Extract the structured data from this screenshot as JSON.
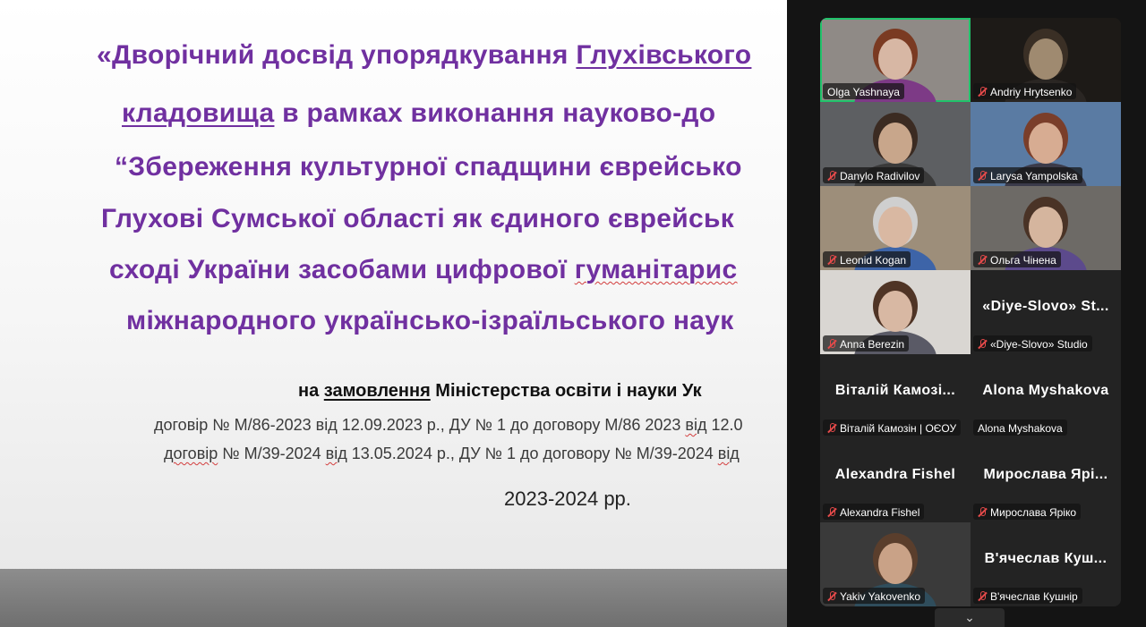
{
  "slide": {
    "title_lines": [
      {
        "parts": [
          {
            "t": "«Дворічний досвід упорядкування "
          },
          {
            "t": "Глухівського",
            "u": true
          }
        ]
      },
      {
        "parts": [
          {
            "t": "кладовища",
            "u": true
          },
          {
            "t": " в рамках виконання науково-до"
          }
        ]
      },
      {
        "parts": [
          {
            "t": "“Збереження культурної спадщини єврейсько"
          }
        ]
      },
      {
        "parts": [
          {
            "t": "Глухові Сумської області як єдиного єврейськ"
          }
        ]
      },
      {
        "parts": [
          {
            "t": "сході України засобами цифрової "
          },
          {
            "t": "гуманітарис",
            "wavy": true
          }
        ]
      },
      {
        "parts": [
          {
            "t": "міжнародного українсько-ізраїльського наук"
          }
        ]
      }
    ],
    "commission_prefix": "на ",
    "commission_word": "замовлення",
    "commission_rest": " Міністерства освіти і науки Ук",
    "contract1_a": "договір № М/86-2023 від 12.09.2023 р., ДУ № 1 до договору  М/86 2023 ",
    "contract1_b": "від",
    "contract1_c": " 12.0",
    "contract2_a": "договір",
    "contract2_b": " № М/39-2024 ",
    "contract2_c": "від",
    "contract2_d": " 13.05.2024 р., ДУ № 1 до договору № М/39-2024 ",
    "contract2_e": "від",
    "years": "2023-2024 рр."
  },
  "participants": [
    {
      "tag": "Olga Yashnaya",
      "muted": false,
      "video": true,
      "active": true,
      "bg": "#8f8a86",
      "face": "#d7b7a4",
      "hair": "#7a3a22",
      "shirt": "#7d3a86"
    },
    {
      "tag": "Andriy Hrytsenko",
      "muted": true,
      "video": true,
      "bg": "#1d1a17",
      "face": "#9f8a70",
      "hair": "#3a2f25",
      "shirt": "#2a2623"
    },
    {
      "tag": "Danylo Radivilov",
      "muted": true,
      "video": true,
      "bg": "#5d5f62",
      "face": "#c8a68b",
      "hair": "#3b2b22",
      "shirt": "#3a3a3a"
    },
    {
      "tag": "Larysa Yampolska",
      "muted": true,
      "video": true,
      "bg": "#5a7ba3",
      "face": "#d7ac92",
      "hair": "#7a3e2a",
      "shirt": "#3b3b4a"
    },
    {
      "tag": "Leonid Kogan",
      "muted": true,
      "video": true,
      "bg": "#9d8e7a",
      "face": "#d9b8a2",
      "hair": "#cfcfcf",
      "shirt": "#3d64a8"
    },
    {
      "tag": "Ольга Чінена",
      "muted": true,
      "video": true,
      "bg": "#6d6a66",
      "face": "#d5b59e",
      "hair": "#4a3326",
      "shirt": "#5c4a8c"
    },
    {
      "tag": "Anna Berezin",
      "muted": true,
      "video": true,
      "bg": "#d9d6d2",
      "face": "#d8b8a3",
      "hair": "#4f3425",
      "shirt": "#5a5a66"
    },
    {
      "name": "«Diye-Slovo»  St...",
      "tag": "«Diye-Slovo» Studio",
      "muted": true,
      "video": false
    },
    {
      "name": "Віталій  Камозі...",
      "tag": "Віталій Камозін | ОЄОУ",
      "muted": true,
      "video": false
    },
    {
      "name": "Alona Myshakova",
      "tag": "Alona Myshakova",
      "muted": false,
      "video": false
    },
    {
      "name": "Alexandra Fishel",
      "tag": "Alexandra Fishel",
      "muted": true,
      "video": false
    },
    {
      "name": "Мирослава  Ярі...",
      "tag": "Мирослава Ярiко",
      "muted": true,
      "video": false
    },
    {
      "tag": "Yakiv Yakovenko",
      "muted": true,
      "video": true,
      "bg": "#3a3a3a",
      "face": "#c9a287",
      "hair": "#5a3e2c",
      "shirt": "#2f4d5c"
    },
    {
      "name": "В'ячеслав  Куш...",
      "tag": "В'ячеслав Кушнір",
      "muted": true,
      "video": false
    }
  ],
  "panel": {
    "scroll_glyph": "⌄",
    "colors": {
      "active_border": "#21c36b",
      "title_purple": "#7030a0",
      "muted_red": "#e64a4a"
    }
  }
}
